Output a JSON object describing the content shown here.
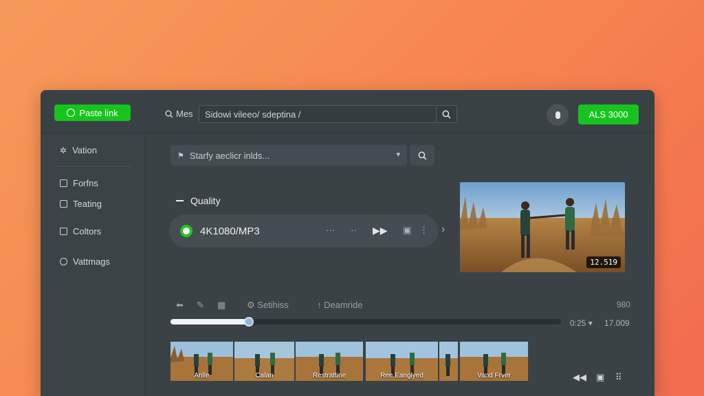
{
  "topbar": {
    "paste_label": "Paste link",
    "search_label": "Mes",
    "url_value": "Sidowi vileeo/ sdeptina /",
    "account_label": "ALS 3000"
  },
  "sidebar": {
    "items": [
      {
        "label": "Vation",
        "icon": "puzzle-icon"
      },
      {
        "label": "Forfns",
        "icon": "file-icon"
      },
      {
        "label": "Teating",
        "icon": "grid-icon"
      },
      {
        "label": "Coltors",
        "icon": "folder-icon"
      },
      {
        "label": "Vattmags",
        "icon": "tag-icon"
      }
    ]
  },
  "main": {
    "filter_placeholder": "Starfy aeclicr inlds...",
    "quality_title": "Quality",
    "format_value": "4K1080/MP3",
    "preview_badge": "12.519",
    "toolbar": {
      "settings_label": "Setihiss",
      "download_label": "Deamride",
      "right_value": "980"
    },
    "timeline": {
      "progress": 0.2,
      "time_current": "0:25",
      "time_total": "17.009"
    },
    "thumbnails": [
      {
        "caption": "Anlle"
      },
      {
        "caption": "Calan"
      },
      {
        "caption": "Restrattine"
      },
      {
        "caption": "Ree Eanglyed"
      },
      {
        "caption": ""
      },
      {
        "caption": "Vand Frver"
      }
    ]
  },
  "colors": {
    "accent": "#17c41d",
    "panel": "#3a4246",
    "background_gradient_start": "#f59a5a",
    "background_gradient_end": "#f26b4f"
  }
}
